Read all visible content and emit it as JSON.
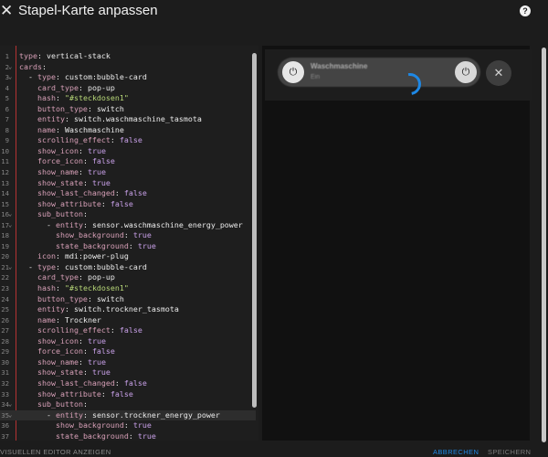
{
  "dialog": {
    "title": "Stapel-Karte anpassen",
    "close_icon": "close-icon",
    "help_icon": "help-icon"
  },
  "editor": {
    "lines": [
      {
        "n": "1",
        "fold": "",
        "code": [
          [
            "k",
            "type"
          ],
          [
            "d",
            ": "
          ],
          [
            "v",
            "vertical-stack"
          ]
        ]
      },
      {
        "n": "2",
        "fold": "v",
        "code": [
          [
            "k",
            "cards"
          ],
          [
            "d",
            ":"
          ]
        ]
      },
      {
        "n": "3",
        "fold": "v",
        "code": [
          [
            "d",
            "  - "
          ],
          [
            "k",
            "type"
          ],
          [
            "d",
            ": "
          ],
          [
            "v",
            "custom:bubble-card"
          ]
        ]
      },
      {
        "n": "4",
        "fold": "",
        "code": [
          [
            "d",
            "    "
          ],
          [
            "k",
            "card_type"
          ],
          [
            "d",
            ": "
          ],
          [
            "v",
            "pop-up"
          ]
        ]
      },
      {
        "n": "5",
        "fold": "",
        "code": [
          [
            "d",
            "    "
          ],
          [
            "k",
            "hash"
          ],
          [
            "d",
            ": "
          ],
          [
            "s",
            "\"#steckdosen1\""
          ]
        ]
      },
      {
        "n": "6",
        "fold": "",
        "code": [
          [
            "d",
            "    "
          ],
          [
            "k",
            "button_type"
          ],
          [
            "d",
            ": "
          ],
          [
            "v",
            "switch"
          ]
        ]
      },
      {
        "n": "7",
        "fold": "",
        "code": [
          [
            "d",
            "    "
          ],
          [
            "k",
            "entity"
          ],
          [
            "d",
            ": "
          ],
          [
            "v",
            "switch.waschmaschine_tasmota"
          ]
        ]
      },
      {
        "n": "8",
        "fold": "",
        "code": [
          [
            "d",
            "    "
          ],
          [
            "k",
            "name"
          ],
          [
            "d",
            ": "
          ],
          [
            "v",
            "Waschmaschine"
          ]
        ]
      },
      {
        "n": "9",
        "fold": "",
        "code": [
          [
            "d",
            "    "
          ],
          [
            "k",
            "scrolling_effect"
          ],
          [
            "d",
            ": "
          ],
          [
            "b",
            "false"
          ]
        ]
      },
      {
        "n": "10",
        "fold": "",
        "code": [
          [
            "d",
            "    "
          ],
          [
            "k",
            "show_icon"
          ],
          [
            "d",
            ": "
          ],
          [
            "b",
            "true"
          ]
        ]
      },
      {
        "n": "11",
        "fold": "",
        "code": [
          [
            "d",
            "    "
          ],
          [
            "k",
            "force_icon"
          ],
          [
            "d",
            ": "
          ],
          [
            "b",
            "false"
          ]
        ]
      },
      {
        "n": "12",
        "fold": "",
        "code": [
          [
            "d",
            "    "
          ],
          [
            "k",
            "show_name"
          ],
          [
            "d",
            ": "
          ],
          [
            "b",
            "true"
          ]
        ]
      },
      {
        "n": "13",
        "fold": "",
        "code": [
          [
            "d",
            "    "
          ],
          [
            "k",
            "show_state"
          ],
          [
            "d",
            ": "
          ],
          [
            "b",
            "true"
          ]
        ]
      },
      {
        "n": "14",
        "fold": "",
        "code": [
          [
            "d",
            "    "
          ],
          [
            "k",
            "show_last_changed"
          ],
          [
            "d",
            ": "
          ],
          [
            "b",
            "false"
          ]
        ]
      },
      {
        "n": "15",
        "fold": "",
        "code": [
          [
            "d",
            "    "
          ],
          [
            "k",
            "show_attribute"
          ],
          [
            "d",
            ": "
          ],
          [
            "b",
            "false"
          ]
        ]
      },
      {
        "n": "16",
        "fold": "v",
        "code": [
          [
            "d",
            "    "
          ],
          [
            "k",
            "sub_button"
          ],
          [
            "d",
            ":"
          ]
        ]
      },
      {
        "n": "17",
        "fold": "v",
        "code": [
          [
            "d",
            "      - "
          ],
          [
            "k",
            "entity"
          ],
          [
            "d",
            ": "
          ],
          [
            "v",
            "sensor.waschmaschine_energy_power"
          ]
        ]
      },
      {
        "n": "18",
        "fold": "",
        "code": [
          [
            "d",
            "        "
          ],
          [
            "k",
            "show_background"
          ],
          [
            "d",
            ": "
          ],
          [
            "b",
            "true"
          ]
        ]
      },
      {
        "n": "19",
        "fold": "",
        "code": [
          [
            "d",
            "        "
          ],
          [
            "k",
            "state_background"
          ],
          [
            "d",
            ": "
          ],
          [
            "b",
            "true"
          ]
        ]
      },
      {
        "n": "20",
        "fold": "",
        "code": [
          [
            "d",
            "    "
          ],
          [
            "k",
            "icon"
          ],
          [
            "d",
            ": "
          ],
          [
            "v",
            "mdi:power-plug"
          ]
        ]
      },
      {
        "n": "21",
        "fold": "v",
        "code": [
          [
            "d",
            "  - "
          ],
          [
            "k",
            "type"
          ],
          [
            "d",
            ": "
          ],
          [
            "v",
            "custom:bubble-card"
          ]
        ]
      },
      {
        "n": "22",
        "fold": "",
        "code": [
          [
            "d",
            "    "
          ],
          [
            "k",
            "card_type"
          ],
          [
            "d",
            ": "
          ],
          [
            "v",
            "pop-up"
          ]
        ]
      },
      {
        "n": "23",
        "fold": "",
        "code": [
          [
            "d",
            "    "
          ],
          [
            "k",
            "hash"
          ],
          [
            "d",
            ": "
          ],
          [
            "s",
            "\"#steckdosen1\""
          ]
        ]
      },
      {
        "n": "24",
        "fold": "",
        "code": [
          [
            "d",
            "    "
          ],
          [
            "k",
            "button_type"
          ],
          [
            "d",
            ": "
          ],
          [
            "v",
            "switch"
          ]
        ]
      },
      {
        "n": "25",
        "fold": "",
        "code": [
          [
            "d",
            "    "
          ],
          [
            "k",
            "entity"
          ],
          [
            "d",
            ": "
          ],
          [
            "v",
            "switch.trockner_tasmota"
          ]
        ]
      },
      {
        "n": "26",
        "fold": "",
        "code": [
          [
            "d",
            "    "
          ],
          [
            "k",
            "name"
          ],
          [
            "d",
            ": "
          ],
          [
            "v",
            "Trockner"
          ]
        ]
      },
      {
        "n": "27",
        "fold": "",
        "code": [
          [
            "d",
            "    "
          ],
          [
            "k",
            "scrolling_effect"
          ],
          [
            "d",
            ": "
          ],
          [
            "b",
            "false"
          ]
        ]
      },
      {
        "n": "28",
        "fold": "",
        "code": [
          [
            "d",
            "    "
          ],
          [
            "k",
            "show_icon"
          ],
          [
            "d",
            ": "
          ],
          [
            "b",
            "true"
          ]
        ]
      },
      {
        "n": "29",
        "fold": "",
        "code": [
          [
            "d",
            "    "
          ],
          [
            "k",
            "force_icon"
          ],
          [
            "d",
            ": "
          ],
          [
            "b",
            "false"
          ]
        ]
      },
      {
        "n": "30",
        "fold": "",
        "code": [
          [
            "d",
            "    "
          ],
          [
            "k",
            "show_name"
          ],
          [
            "d",
            ": "
          ],
          [
            "b",
            "true"
          ]
        ]
      },
      {
        "n": "31",
        "fold": "",
        "code": [
          [
            "d",
            "    "
          ],
          [
            "k",
            "show_state"
          ],
          [
            "d",
            ": "
          ],
          [
            "b",
            "true"
          ]
        ]
      },
      {
        "n": "32",
        "fold": "",
        "code": [
          [
            "d",
            "    "
          ],
          [
            "k",
            "show_last_changed"
          ],
          [
            "d",
            ": "
          ],
          [
            "b",
            "false"
          ]
        ]
      },
      {
        "n": "33",
        "fold": "",
        "code": [
          [
            "d",
            "    "
          ],
          [
            "k",
            "show_attribute"
          ],
          [
            "d",
            ": "
          ],
          [
            "b",
            "false"
          ]
        ]
      },
      {
        "n": "34",
        "fold": "v",
        "code": [
          [
            "d",
            "    "
          ],
          [
            "k",
            "sub_button"
          ],
          [
            "d",
            ":"
          ]
        ]
      },
      {
        "n": "35",
        "fold": "v",
        "active": true,
        "code": [
          [
            "d",
            "      - "
          ],
          [
            "k",
            "entity"
          ],
          [
            "d",
            ": "
          ],
          [
            "v",
            "sensor.trockner_energy_power"
          ]
        ]
      },
      {
        "n": "36",
        "fold": "",
        "code": [
          [
            "d",
            "        "
          ],
          [
            "k",
            "show_background"
          ],
          [
            "d",
            ": "
          ],
          [
            "b",
            "true"
          ]
        ]
      },
      {
        "n": "37",
        "fold": "",
        "code": [
          [
            "d",
            "        "
          ],
          [
            "k",
            "state_background"
          ],
          [
            "d",
            ": "
          ],
          [
            "b",
            "true"
          ]
        ]
      }
    ]
  },
  "preview": {
    "bubble_name": "Waschmaschine",
    "bubble_state": "Ein",
    "bubble_icon": "power-plug-icon",
    "sub_button_icon": "power-plug-icon",
    "close_icon": "close-icon",
    "loading_icon": "spinner-icon",
    "accent_color": "#1e88e5"
  },
  "footer": {
    "visual_editor_label": "VISUELLEN EDITOR ANZEIGEN",
    "cancel_label": "ABBRECHEN",
    "save_label": "SPEICHERN"
  }
}
